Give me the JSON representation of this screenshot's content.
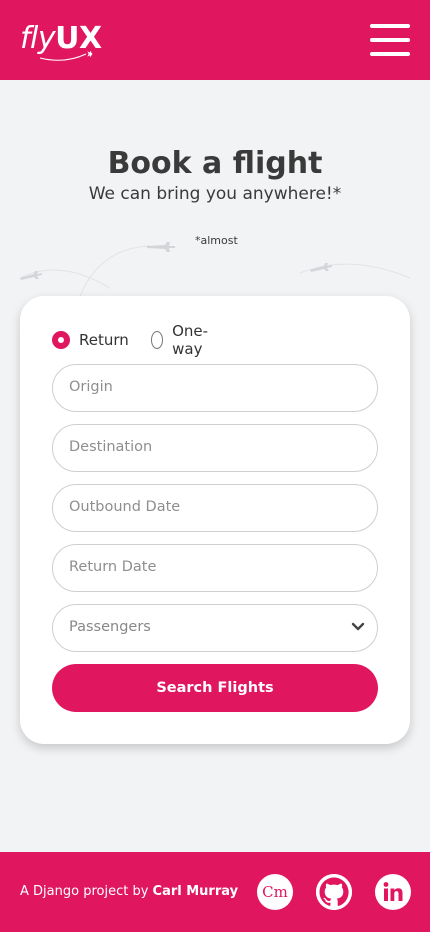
{
  "brand": {
    "logo_fly": "fly",
    "logo_ux": "UX",
    "accent_color": "#e0175f"
  },
  "header": {
    "menu_icon": "hamburger-menu-icon"
  },
  "hero": {
    "title": "Book a flight",
    "subtitle": "We can bring you anywhere!*",
    "footnote": "*almost"
  },
  "form": {
    "trip_type": {
      "options": [
        "Return",
        "One-way"
      ],
      "selected": "Return"
    },
    "fields": {
      "origin_placeholder": "Origin",
      "destination_placeholder": "Destination",
      "outbound_placeholder": "Outbound Date",
      "return_placeholder": "Return Date",
      "passengers_placeholder": "Passengers"
    },
    "submit_label": "Search Flights"
  },
  "footer": {
    "text_prefix": "A Django project by ",
    "author": "Carl Murray",
    "cm_label": "Cm",
    "social_icons": [
      "cm-logo-icon",
      "github-icon",
      "linkedin-icon"
    ]
  }
}
